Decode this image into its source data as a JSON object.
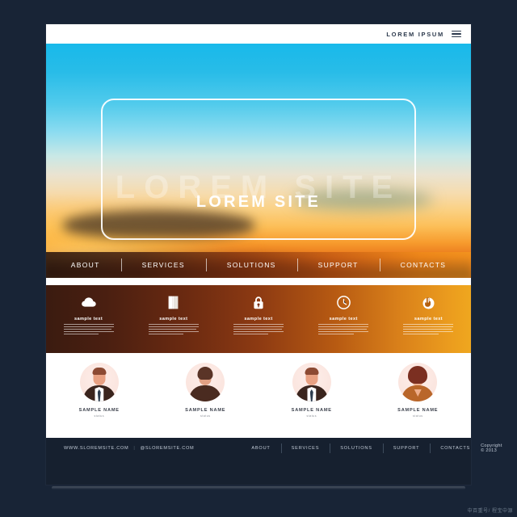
{
  "header": {
    "brand": "LOREM IPSUM",
    "menu_icon": "hamburger-menu-icon"
  },
  "hero": {
    "ghost_title": "LOREM SITE",
    "title": "LOREM SITE",
    "background": "blurred-sunset-landscape",
    "colors": {
      "sky_top": "#18b9ea",
      "sky_mid": "#c9e8e6",
      "sun": "#fbd183",
      "horizon": "#e9761b",
      "ground": "#7d3313"
    },
    "nav": [
      {
        "label": "ABOUT"
      },
      {
        "label": "SERVICES"
      },
      {
        "label": "SOLUTIONS"
      },
      {
        "label": "SUPPORT"
      },
      {
        "label": "CONTACTS"
      }
    ]
  },
  "features": {
    "items": [
      {
        "icon": "cloud-icon",
        "title": "sample text"
      },
      {
        "icon": "open-book-icon",
        "title": "sample text"
      },
      {
        "icon": "lock-icon",
        "title": "sample text"
      },
      {
        "icon": "clock-icon",
        "title": "sample text"
      },
      {
        "icon": "hand-click-icon",
        "title": "sample text"
      }
    ],
    "colors": {
      "gradient_start": "#3b1b10",
      "gradient_end": "#efa71f"
    }
  },
  "team": {
    "members": [
      {
        "name": "SAMPLE NAME",
        "role": "status"
      },
      {
        "name": "SAMPLE NAME",
        "role": "status"
      },
      {
        "name": "SAMPLE NAME",
        "role": "status"
      },
      {
        "name": "SAMPLE NAME",
        "role": "status"
      }
    ]
  },
  "footer": {
    "website": "WWW.SLOREMSITE.COM",
    "separator": "|",
    "email": "@SLOREMSITE.COM",
    "nav": [
      {
        "label": "ABOUT"
      },
      {
        "label": "SERVICES"
      },
      {
        "label": "SOLUTIONS"
      },
      {
        "label": "SUPPORT"
      },
      {
        "label": "CONTACTS"
      }
    ],
    "copyright": "Copyright © 2013"
  },
  "watermark": "中百重号/ 程宝中源"
}
